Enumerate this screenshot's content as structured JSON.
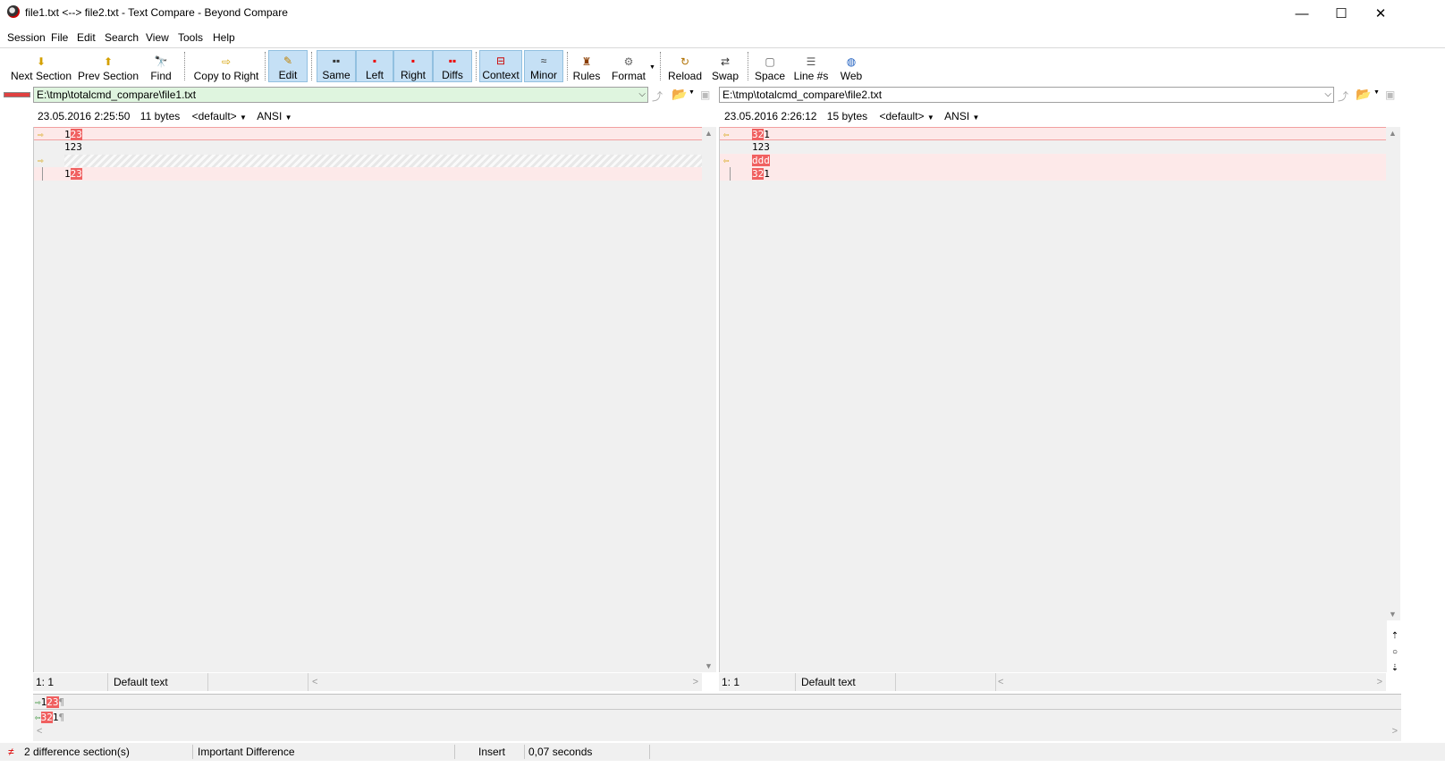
{
  "window": {
    "title": "file1.txt <--> file2.txt - Text Compare - Beyond Compare",
    "minimize": "—",
    "maximize": "☐",
    "close": "✕"
  },
  "menu": [
    "Session",
    "File",
    "Edit",
    "Search",
    "View",
    "Tools",
    "Help"
  ],
  "toolbar": {
    "next_section": "Next Section",
    "prev_section": "Prev Section",
    "find": "Find",
    "copy_to_right": "Copy to Right",
    "edit": "Edit",
    "same": "Same",
    "left": "Left",
    "right": "Right",
    "diffs": "Diffs",
    "context": "Context",
    "minor": "Minor",
    "rules": "Rules",
    "format": "Format",
    "reload": "Reload",
    "swap": "Swap",
    "space": "Space",
    "line_numbers": "Line #s",
    "web": "Web"
  },
  "left": {
    "path": "E:\\tmp\\totalcmd_compare\\file1.txt",
    "date": "23.05.2016 2:25:50",
    "size": "11 bytes",
    "format": "<default>",
    "encoding": "ANSI",
    "lines": [
      {
        "plain": "1",
        "hl": "23"
      },
      {
        "plain": "123",
        "hl": ""
      },
      {
        "plain": "",
        "hl": ""
      },
      {
        "plain": "1",
        "hl": "23"
      }
    ],
    "cursor": "1: 1",
    "text_type": "Default text"
  },
  "right": {
    "path": "E:\\tmp\\totalcmd_compare\\file2.txt",
    "date": "23.05.2016 2:26:12",
    "size": "15 bytes",
    "format": "<default>",
    "encoding": "ANSI",
    "lines": [
      {
        "hl": "32",
        "plain": "1"
      },
      {
        "hl": "",
        "plain": "123"
      },
      {
        "hl": "ddd",
        "plain": ""
      },
      {
        "hl": "32",
        "plain": "1"
      }
    ],
    "cursor": "1: 1",
    "text_type": "Default text"
  },
  "line_details": {
    "left": {
      "plain": "1",
      "hl": "23",
      "mark": "¶"
    },
    "right": {
      "hl": "32",
      "plain": "1",
      "mark": "¶"
    }
  },
  "status": {
    "differences": "2 difference section(s)",
    "importance": "Important Difference",
    "mode": "Insert",
    "time": "0,07 seconds"
  },
  "colors": {
    "diff_highlight": "#f06060",
    "diff_row": "#fde9e9",
    "left_path_bg": "#dff5df",
    "active_button": "#c5e0f5"
  }
}
